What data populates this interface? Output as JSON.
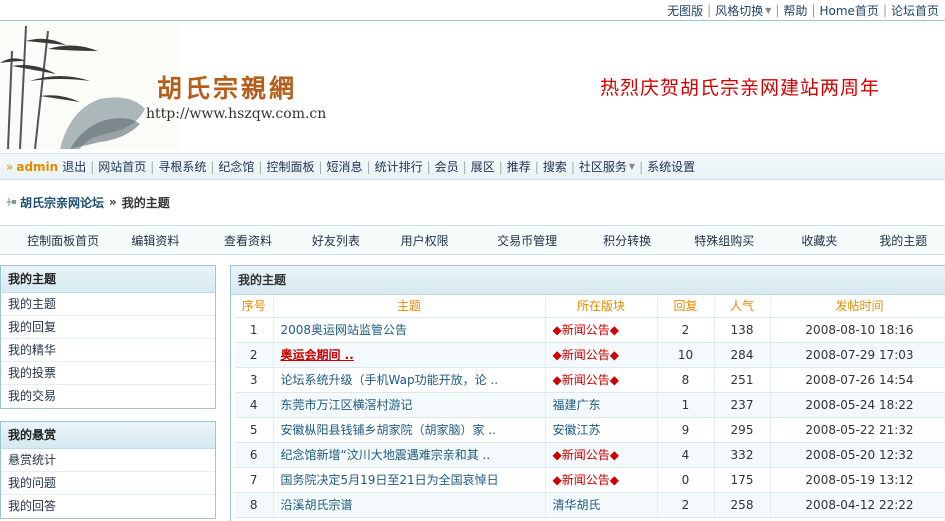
{
  "toplinks": [
    {
      "label": "无图版",
      "dropdown": false
    },
    {
      "label": "风格切换",
      "dropdown": true
    },
    {
      "label": "帮助",
      "dropdown": false
    },
    {
      "label": "Home首页",
      "dropdown": false
    },
    {
      "label": "论坛首页",
      "dropdown": false
    }
  ],
  "header": {
    "site_name": "胡氏宗親網",
    "site_url": "http://www.hszqw.com.cn",
    "banner": "热烈庆贺胡氏宗亲网建站两周年"
  },
  "mainnav": {
    "prefix": "»",
    "user": "admin",
    "items": [
      {
        "label": "退出",
        "dropdown": false
      },
      {
        "label": "网站首页",
        "dropdown": false
      },
      {
        "label": "寻根系统",
        "dropdown": false
      },
      {
        "label": "纪念馆",
        "dropdown": false
      },
      {
        "label": "控制面板",
        "dropdown": false
      },
      {
        "label": "短消息",
        "dropdown": false
      },
      {
        "label": "统计排行",
        "dropdown": false
      },
      {
        "label": "会员",
        "dropdown": false
      },
      {
        "label": "展区",
        "dropdown": false
      },
      {
        "label": "推荐",
        "dropdown": false
      },
      {
        "label": "搜索",
        "dropdown": false
      },
      {
        "label": "社区服务",
        "dropdown": true
      },
      {
        "label": "系统设置",
        "dropdown": false
      }
    ]
  },
  "breadcrumb": {
    "forum": "胡氏宗亲网论坛",
    "separator": "»",
    "current": "我的主题"
  },
  "subnav": [
    "控制面板首页",
    "编辑资料",
    "查看资料",
    "好友列表",
    "用户权限",
    "交易币管理",
    "积分转换",
    "特殊组购买",
    "收藏夹",
    "我的主题"
  ],
  "sidebar": {
    "box1": {
      "title": "我的主题",
      "items": [
        "我的主题",
        "我的回复",
        "我的精华",
        "我的投票",
        "我的交易"
      ]
    },
    "box2": {
      "title": "我的悬赏",
      "items": [
        "悬赏统计",
        "我的问题",
        "我的回答"
      ]
    }
  },
  "main": {
    "title": "我的主题",
    "columns": [
      "序号",
      "主题",
      "所在版块",
      "回复",
      "人气",
      "发帖时间"
    ],
    "rows": [
      {
        "no": "1",
        "title": "2008奥运网站监管公告",
        "hot": false,
        "forum": "◆新闻公告◆",
        "news": true,
        "replies": "2",
        "views": "138",
        "time": "2008-08-10 18:16"
      },
      {
        "no": "2",
        "title": "奥运会期间 ..",
        "hot": true,
        "forum": "◆新闻公告◆",
        "news": true,
        "replies": "10",
        "views": "284",
        "time": "2008-07-29 17:03"
      },
      {
        "no": "3",
        "title": "论坛系统升级（手机Wap功能开放，论 ..",
        "hot": false,
        "forum": "◆新闻公告◆",
        "news": true,
        "replies": "8",
        "views": "251",
        "time": "2008-07-26 14:54"
      },
      {
        "no": "4",
        "title": "东莞市万江区横滘村游记",
        "hot": false,
        "forum": "福建广东",
        "news": false,
        "replies": "1",
        "views": "237",
        "time": "2008-05-24 18:22"
      },
      {
        "no": "5",
        "title": "安徽枞阳县钱铺乡胡家院（胡家脑）家 ..",
        "hot": false,
        "forum": "安徽江苏",
        "news": false,
        "replies": "9",
        "views": "295",
        "time": "2008-05-22 21:32"
      },
      {
        "no": "6",
        "title": "纪念馆新增“汶川大地震遇难宗亲和其 ..",
        "hot": false,
        "forum": "◆新闻公告◆",
        "news": true,
        "replies": "4",
        "views": "332",
        "time": "2008-05-20 12:32"
      },
      {
        "no": "7",
        "title": "国务院决定5月19日至21日为全国哀悼日",
        "hot": false,
        "forum": "◆新闻公告◆",
        "news": true,
        "replies": "0",
        "views": "175",
        "time": "2008-05-19 13:12"
      },
      {
        "no": "8",
        "title": "沿溪胡氏宗谱",
        "hot": false,
        "forum": "清华胡氏",
        "news": false,
        "replies": "2",
        "views": "258",
        "time": "2008-04-12 22:22"
      }
    ]
  }
}
